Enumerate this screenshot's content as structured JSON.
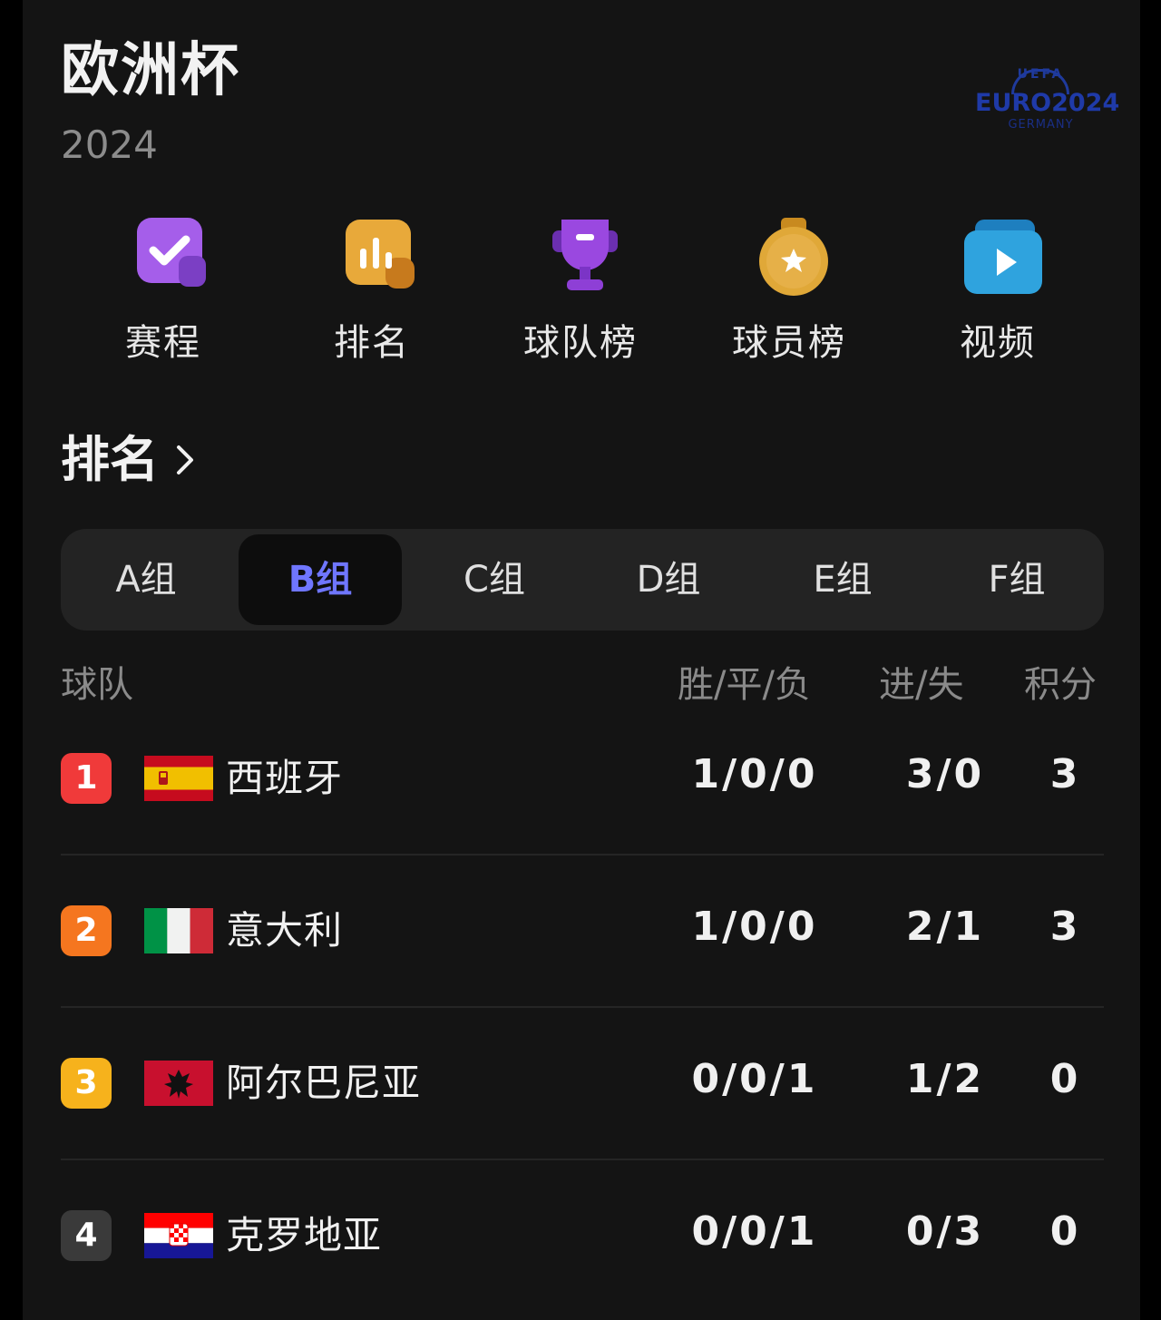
{
  "header": {
    "title": "欧洲杯",
    "year": "2024",
    "logo": {
      "top": "UEFA",
      "main": "EURO2024",
      "sub": "GERMANY"
    }
  },
  "nav": [
    {
      "label": "赛程",
      "icon": "calendar-check-icon",
      "color": "#9b59e6"
    },
    {
      "label": "排名",
      "icon": "bar-chart-icon",
      "color": "#e8a93a"
    },
    {
      "label": "球队榜",
      "icon": "trophy-icon",
      "color": "#8e3fd6"
    },
    {
      "label": "球员榜",
      "icon": "medal-star-icon",
      "color": "#e0a838"
    },
    {
      "label": "视频",
      "icon": "play-video-icon",
      "color": "#2d9fd9"
    }
  ],
  "section": {
    "title": "排名"
  },
  "tabs": [
    {
      "label": "A组",
      "active": false
    },
    {
      "label": "B组",
      "active": true
    },
    {
      "label": "C组",
      "active": false
    },
    {
      "label": "D组",
      "active": false
    },
    {
      "label": "E组",
      "active": false
    },
    {
      "label": "F组",
      "active": false
    }
  ],
  "table": {
    "headers": {
      "team": "球队",
      "wdl": "胜/平/负",
      "goals": "进/失",
      "points": "积分"
    },
    "rows": [
      {
        "rank": "1",
        "rank_color": "#f03a3a",
        "flag": "spain-flag",
        "team": "西班牙",
        "wdl": "1/0/0",
        "goals": "3/0",
        "points": "3"
      },
      {
        "rank": "2",
        "rank_color": "#f5761f",
        "flag": "italy-flag",
        "team": "意大利",
        "wdl": "1/0/0",
        "goals": "2/1",
        "points": "3"
      },
      {
        "rank": "3",
        "rank_color": "#f6b21c",
        "flag": "albania-flag",
        "team": "阿尔巴尼亚",
        "wdl": "0/0/1",
        "goals": "1/2",
        "points": "0"
      },
      {
        "rank": "4",
        "rank_color": "#3a3a3a",
        "flag": "croatia-flag",
        "team": "克罗地亚",
        "wdl": "0/0/1",
        "goals": "0/3",
        "points": "0"
      }
    ]
  },
  "colors": {
    "accent": "#6f76ff",
    "background": "#141414"
  }
}
